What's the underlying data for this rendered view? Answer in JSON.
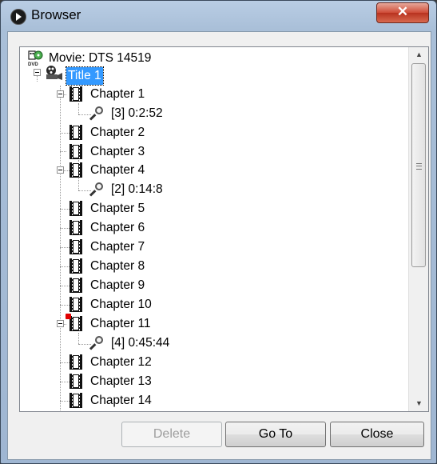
{
  "window": {
    "title": "Browser",
    "close_glyph": "✕"
  },
  "tree": {
    "root": {
      "label": "Movie: DTS 14519",
      "icon": "dvd-movie-icon"
    },
    "title": {
      "label": "Title 1",
      "icon": "film-reel-icon",
      "selected": true
    },
    "items": [
      {
        "label": "Chapter 1"
      },
      {
        "label": "[3]  0:2:52"
      },
      {
        "label": "Chapter 2"
      },
      {
        "label": "Chapter 3"
      },
      {
        "label": "Chapter 4"
      },
      {
        "label": "[2]  0:14:8"
      },
      {
        "label": "Chapter 5"
      },
      {
        "label": "Chapter 6"
      },
      {
        "label": "Chapter 7"
      },
      {
        "label": "Chapter 8"
      },
      {
        "label": "Chapter 9"
      },
      {
        "label": "Chapter 10"
      },
      {
        "label": "Chapter 11"
      },
      {
        "label": "[4]  0:45:44"
      },
      {
        "label": "Chapter 12"
      },
      {
        "label": "Chapter 13"
      },
      {
        "label": "Chapter 14"
      }
    ]
  },
  "buttons": {
    "delete": "Delete",
    "goto": "Go To",
    "close": "Close"
  },
  "colors": {
    "selection": "#3399ff",
    "marker": "#e00000",
    "close_button": "#c8432f"
  }
}
